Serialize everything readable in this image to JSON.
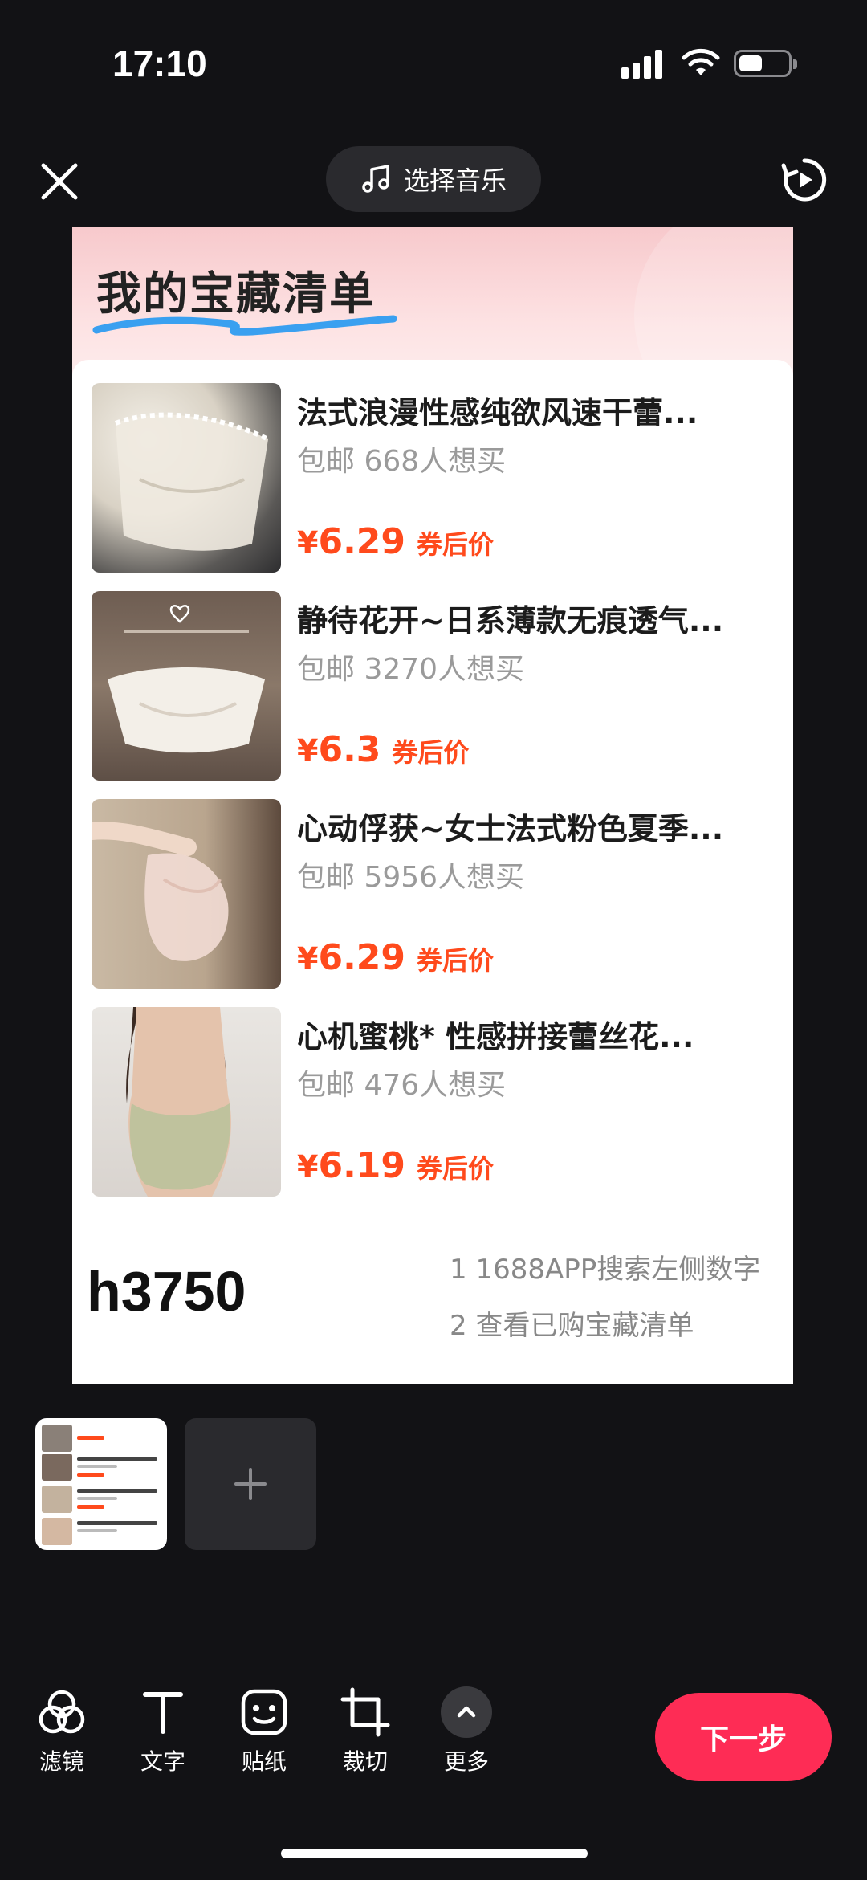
{
  "status_bar": {
    "time": "17:10"
  },
  "top_bar": {
    "music_label": "选择音乐"
  },
  "preview": {
    "title": "我的宝藏清单",
    "items": [
      {
        "title": "法式浪漫性感纯欲风速干蕾...",
        "sub": "包邮 668人想买",
        "yen": "¥",
        "price": "6.29",
        "tag": "券后价"
      },
      {
        "title": "静待花开~日系薄款无痕透气...",
        "sub": "包邮 3270人想买",
        "yen": "¥",
        "price": "6.3",
        "tag": "券后价"
      },
      {
        "title": "心动俘获~女士法式粉色夏季...",
        "sub": "包邮 5956人想买",
        "yen": "¥",
        "price": "6.29",
        "tag": "券后价"
      },
      {
        "title": "心机蜜桃* 性感拼接蕾丝花...",
        "sub": "包邮 476人想买",
        "yen": "¥",
        "price": "6.19",
        "tag": "券后价"
      }
    ],
    "code": "h3750",
    "step1": "1 1688APP搜索左侧数字",
    "step2": "2 查看已购宝藏清单"
  },
  "toolbar": {
    "filter": "滤镜",
    "text": "文字",
    "sticker": "贴纸",
    "crop": "裁切",
    "more": "更多",
    "next": "下一步"
  },
  "colors": {
    "accent": "#fe2c55",
    "price": "#ff4a1c",
    "background": "#121215"
  }
}
